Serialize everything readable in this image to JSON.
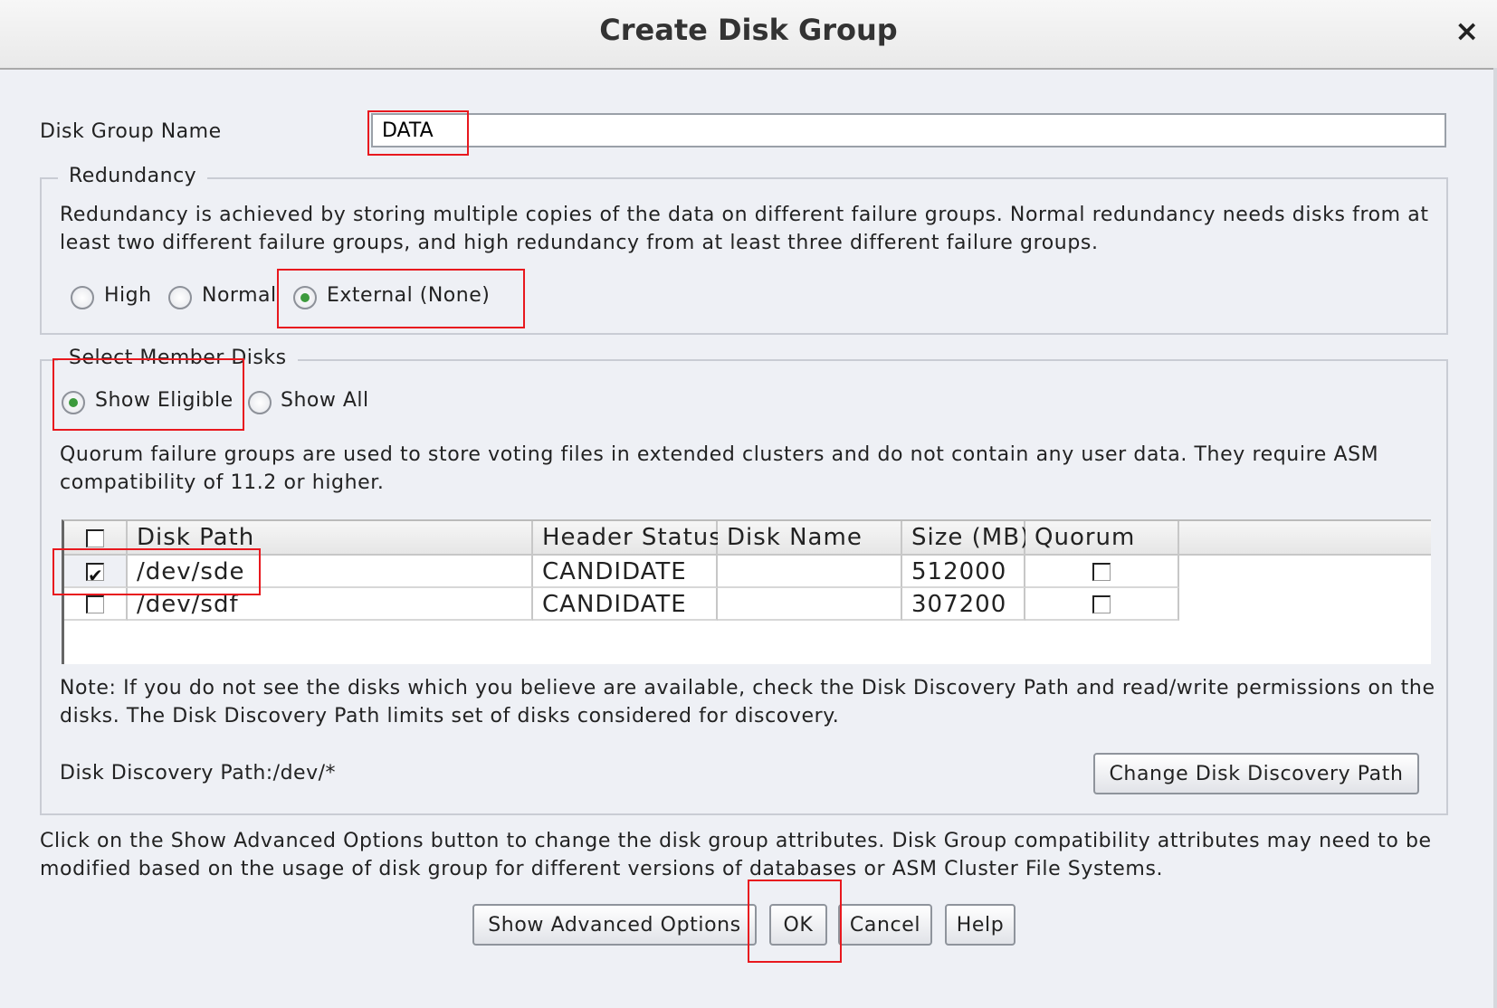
{
  "window": {
    "title": "Create Disk Group",
    "close_glyph": "×"
  },
  "disk_group_name": {
    "label": "Disk Group Name",
    "value": "DATA"
  },
  "redundancy": {
    "legend": "Redundancy",
    "description": "Redundancy is achieved by storing multiple copies of the data on different failure groups. Normal redundancy needs disks from at least two different failure groups, and high redundancy from at least three different failure groups.",
    "options": [
      {
        "label": "High",
        "selected": false
      },
      {
        "label": "Normal",
        "selected": false
      },
      {
        "label": "External (None)",
        "selected": true
      }
    ]
  },
  "member_disks": {
    "legend": "Select Member Disks",
    "filter_options": [
      {
        "label": "Show Eligible",
        "selected": true
      },
      {
        "label": "Show All",
        "selected": false
      }
    ],
    "quorum_note": "Quorum failure groups are used to store voting files in extended clusters and do not contain any user data. They require ASM compatibility of 11.2 or higher.",
    "table": {
      "columns": [
        "Disk Path",
        "Header Status",
        "Disk Name",
        "Size (MB)",
        "Quorum"
      ],
      "rows": [
        {
          "selected": true,
          "path": "/dev/sde",
          "status": "CANDIDATE",
          "name": "",
          "size": "512000",
          "quorum": false
        },
        {
          "selected": false,
          "path": "/dev/sdf",
          "status": "CANDIDATE",
          "name": "",
          "size": "307200",
          "quorum": false
        }
      ]
    },
    "discovery_note": "Note: If you do not see the disks which you believe are available, check the Disk Discovery Path and read/write permissions on the disks. The Disk Discovery Path limits set of disks considered for discovery.",
    "discovery_path": "Disk Discovery Path:/dev/*",
    "change_path_button": "Change Disk Discovery Path"
  },
  "advanced_note": "Click on the Show Advanced Options button to change the disk group attributes. Disk Group compatibility attributes may need to be modified based on the usage of disk group for different versions of databases or ASM Cluster File Systems.",
  "buttons": {
    "advanced": "Show Advanced Options",
    "ok": "OK",
    "cancel": "Cancel",
    "help": "Help"
  },
  "colors": {
    "highlight": "#e8181e",
    "radio_selected": "#3c9a3c",
    "dialog_bg": "#eef0f5"
  }
}
